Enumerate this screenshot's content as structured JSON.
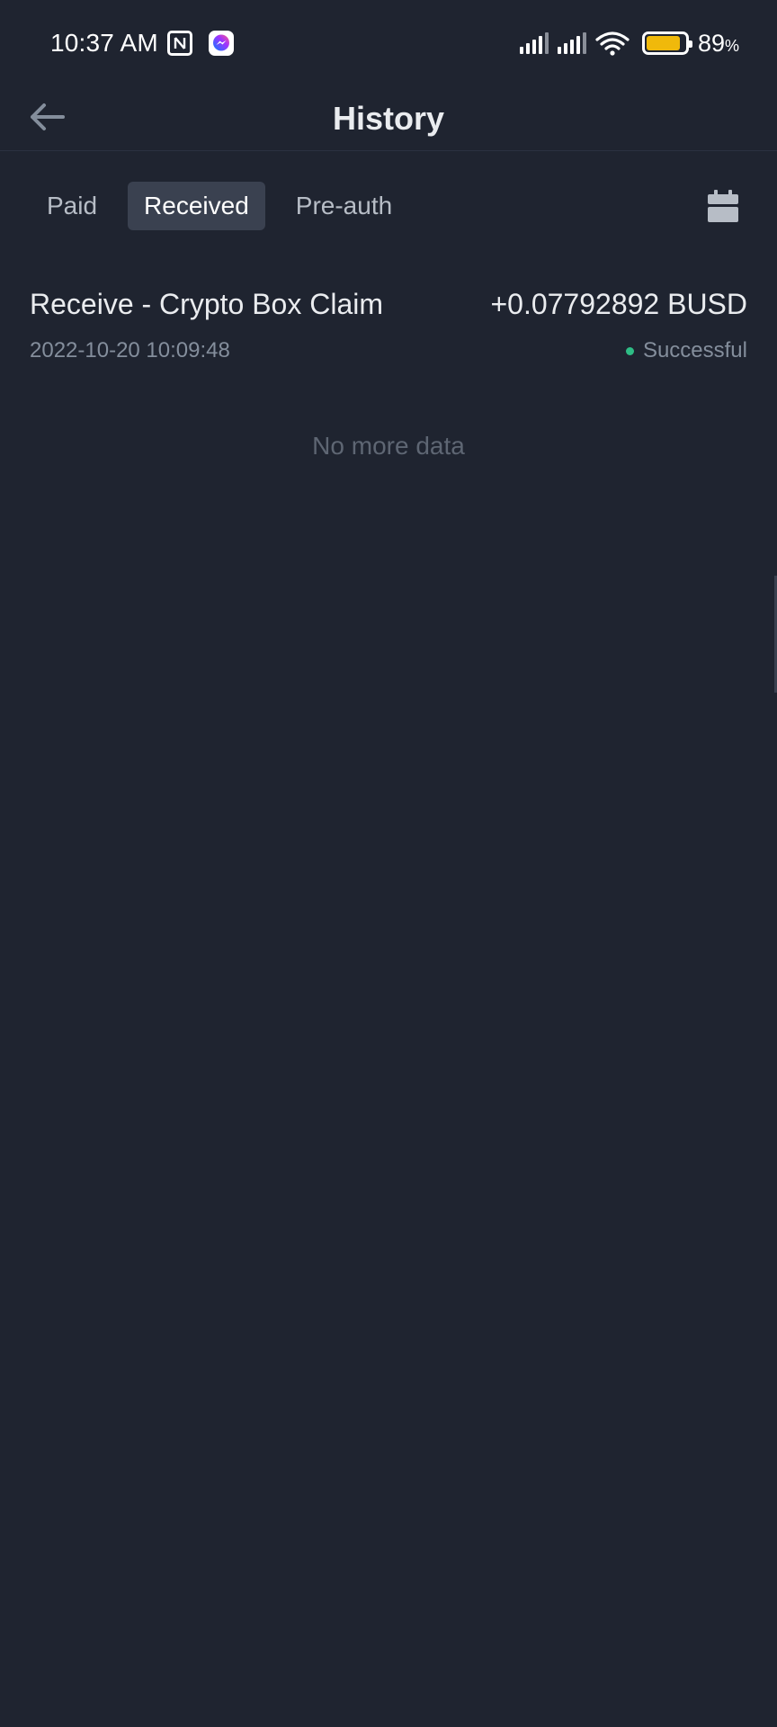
{
  "status_bar": {
    "time": "10:37 AM",
    "battery_percent": "89",
    "battery_unit": "%",
    "battery_level": 0.89,
    "icons": [
      "nfc-icon",
      "messenger-icon",
      "signal-icon",
      "signal-icon",
      "wifi-icon",
      "battery-icon"
    ]
  },
  "header": {
    "title": "History",
    "back_icon": "arrow-left-icon"
  },
  "tabs": [
    {
      "label": "Paid",
      "active": false
    },
    {
      "label": "Received",
      "active": true
    },
    {
      "label": "Pre-auth",
      "active": false
    }
  ],
  "filter_icon": "calendar-icon",
  "records": [
    {
      "title": "Receive - Crypto Box Claim",
      "amount": "+0.07792892 BUSD",
      "time": "2022-10-20 10:09:48",
      "status": "Successful"
    }
  ],
  "footer_text": "No more data",
  "colors": {
    "background": "#1f2430",
    "accent": "#f0b90b",
    "success": "#2ebd85",
    "active_tab": "#3a4150"
  }
}
